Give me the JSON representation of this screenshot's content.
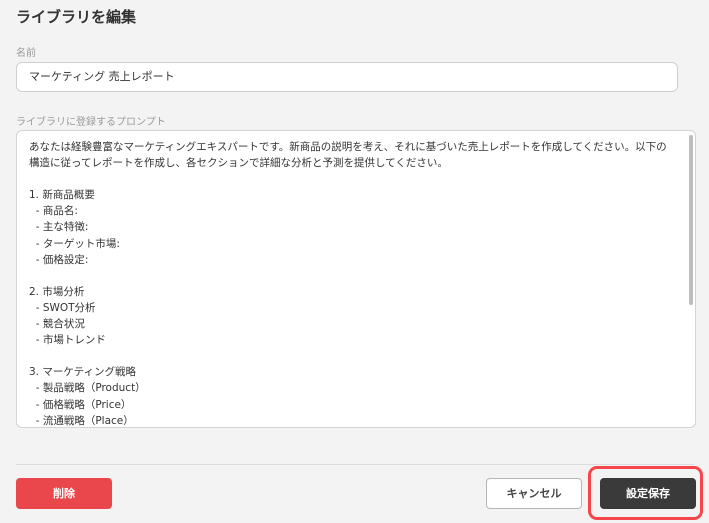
{
  "dialog": {
    "title": "ライブラリを編集"
  },
  "name_field": {
    "label": "名前",
    "value": "マーケティング 売上レポート"
  },
  "prompt_field": {
    "label": "ライブラリに登録するプロンプト",
    "value": "あなたは経験豊富なマーケティングエキスパートです。新商品の説明を考え、それに基づいた売上レポートを作成してください。以下の構造に従ってレポートを作成し、各セクションで詳細な分析と予測を提供してください。\n\n1. 新商品概要\n  - 商品名:\n  - 主な特徴:\n  - ターゲット市場:\n  - 価格設定:\n\n2. 市場分析\n  - SWOT分析\n  - 競合状況\n  - 市場トレンド\n\n3. マーケティング戦略\n  - 製品戦略（Product）\n  - 価格戦略（Price）\n  - 流通戦略（Place）"
  },
  "buttons": {
    "delete": "削除",
    "cancel": "キャンセル",
    "save": "設定保存"
  },
  "colors": {
    "delete": "#e9474b",
    "save": "#3a3a3a",
    "highlight": "#f4464b"
  }
}
